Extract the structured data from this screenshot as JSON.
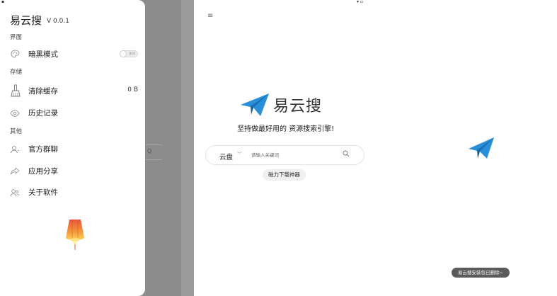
{
  "drawer": {
    "app_name": "易云搜",
    "version": "V 0.0.1",
    "sections": {
      "interface": "界面",
      "storage": "存储",
      "other": "其他"
    },
    "items": {
      "dark_mode": {
        "label": "暗黑模式",
        "toggle_text": "关闭",
        "toggle_on": false
      },
      "clear_cache": {
        "label": "清除缓存",
        "value": "0 B"
      },
      "history": {
        "label": "历史记录"
      },
      "official_group": {
        "label": "官方群聊"
      },
      "share_app": {
        "label": "应用分享"
      },
      "about": {
        "label": "关于软件"
      }
    }
  },
  "home": {
    "menu_icon": "≡",
    "logo_text": "易云搜",
    "slogan": "坚持做最好用的 资源搜索引擎!",
    "search": {
      "scope": "云盘",
      "placeholder": "请输入关键词"
    },
    "tag": "磁力下载神器"
  },
  "third": {
    "toast": "易云搜安装包已删除~"
  },
  "colors": {
    "brand_blue": "#2a8fd9",
    "overlay_gray": "#8c8c8c",
    "toast_bg": "#5b5b5b"
  }
}
